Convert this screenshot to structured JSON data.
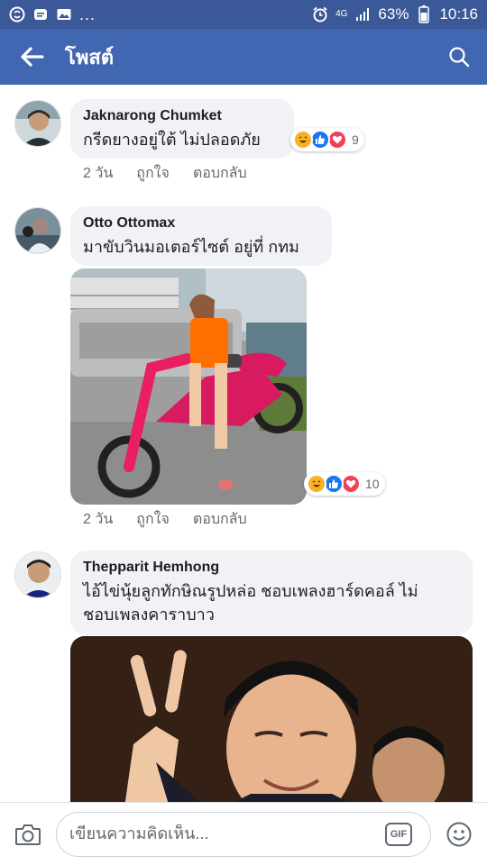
{
  "status_bar": {
    "overflow": "...",
    "network": "4G",
    "battery": "63%",
    "time": "10:16"
  },
  "header": {
    "title": "โพสต์",
    "back_icon": "arrow-left-icon",
    "search_icon": "search-icon"
  },
  "comments": [
    {
      "name": "Jaknarong Chumket",
      "text": "กรีดยางอยู่ใต้ ไม่ปลอดภัย",
      "time": "2 วัน",
      "like": "ถูกใจ",
      "reply": "ตอบกลับ",
      "reaction_count": "9"
    },
    {
      "name": "Otto Ottomax",
      "text": "มาขับวินมอเตอร์ไซต์ อยู่ที่ กทม",
      "time": "2 วัน",
      "like": "ถูกใจ",
      "reply": "ตอบกลับ",
      "reaction_count": "10"
    },
    {
      "name": "Thepparit Hemhong",
      "text_line1": "ไอ้ไข่นุ้ยลูกทักษิณรูปหล่อ ชอบเพลงฮาร์ดคอล์ ไม่",
      "text_line2": "ชอบเพลงคาราบาว"
    }
  ],
  "composer": {
    "placeholder": "เขียนความคิดเห็น...",
    "gif_label": "GIF",
    "camera_icon": "camera-icon",
    "emoji_icon": "smiley-icon"
  },
  "colors": {
    "status_bar": "#3b5998",
    "header": "#4267b2",
    "bubble": "#f0f2f5",
    "like_blue": "#1877f2",
    "love_red": "#f33e58",
    "haha_yellow": "#f7b125"
  }
}
